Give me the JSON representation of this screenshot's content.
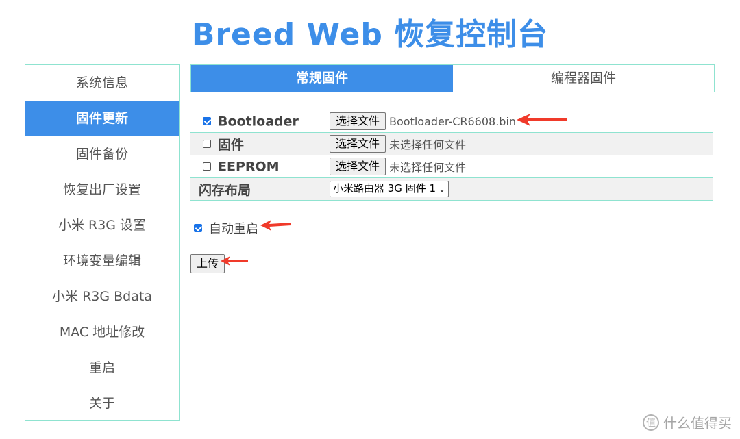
{
  "header": {
    "title": "Breed Web 恢复控制台"
  },
  "sidebar": {
    "items": [
      {
        "label": "系统信息"
      },
      {
        "label": "固件更新"
      },
      {
        "label": "固件备份"
      },
      {
        "label": "恢复出厂设置"
      },
      {
        "label": "小米 R3G 设置"
      },
      {
        "label": "环境变量编辑"
      },
      {
        "label": "小米 R3G Bdata"
      },
      {
        "label": "MAC 地址修改"
      },
      {
        "label": "重启"
      },
      {
        "label": "关于"
      }
    ]
  },
  "tabs": [
    {
      "label": "常规固件"
    },
    {
      "label": "编程器固件"
    }
  ],
  "firmware": {
    "rows": [
      {
        "label": "Bootloader",
        "checked": true,
        "button": "选择文件",
        "file": "Bootloader-CR6608.bin"
      },
      {
        "label": "固件",
        "checked": false,
        "button": "选择文件",
        "file": "未选择任何文件"
      },
      {
        "label": "EEPROM",
        "checked": false,
        "button": "选择文件",
        "file": "未选择任何文件"
      }
    ],
    "flash_layout": {
      "label": "闪存布局",
      "selected": "小米路由器 3G 固件 1"
    }
  },
  "auto_reboot": {
    "label": "自动重启",
    "checked": true
  },
  "upload": {
    "label": "上传"
  },
  "watermark": {
    "text": "什么值得买",
    "logo": "值"
  },
  "colors": {
    "accent": "#3d8ee8",
    "border": "#8fe3d0",
    "arrow": "#f03a2a"
  }
}
